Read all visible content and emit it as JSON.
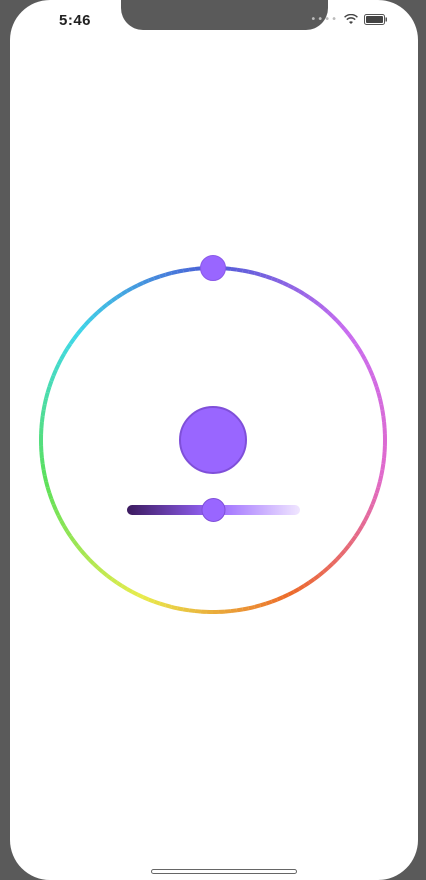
{
  "status_bar": {
    "time": "5:46",
    "signal_icon": "cellular-dots-icon",
    "wifi_icon": "wifi-icon",
    "battery_icon": "battery-icon"
  },
  "color_picker": {
    "selected_color": "#9966FF",
    "selected_color_border": "#7F4FD9",
    "hue_ring_colors": [
      "#4a5cd6",
      "#3fd8e8",
      "#5be05a",
      "#e8ec4c",
      "#ec6a2a",
      "#e06acb",
      "#c86cf0"
    ],
    "brightness_slider": {
      "value": 0.5,
      "start_color": "#3b1a5e",
      "end_color": "#f0e6ff"
    }
  },
  "home_indicator_icon": "home-indicator-bar"
}
